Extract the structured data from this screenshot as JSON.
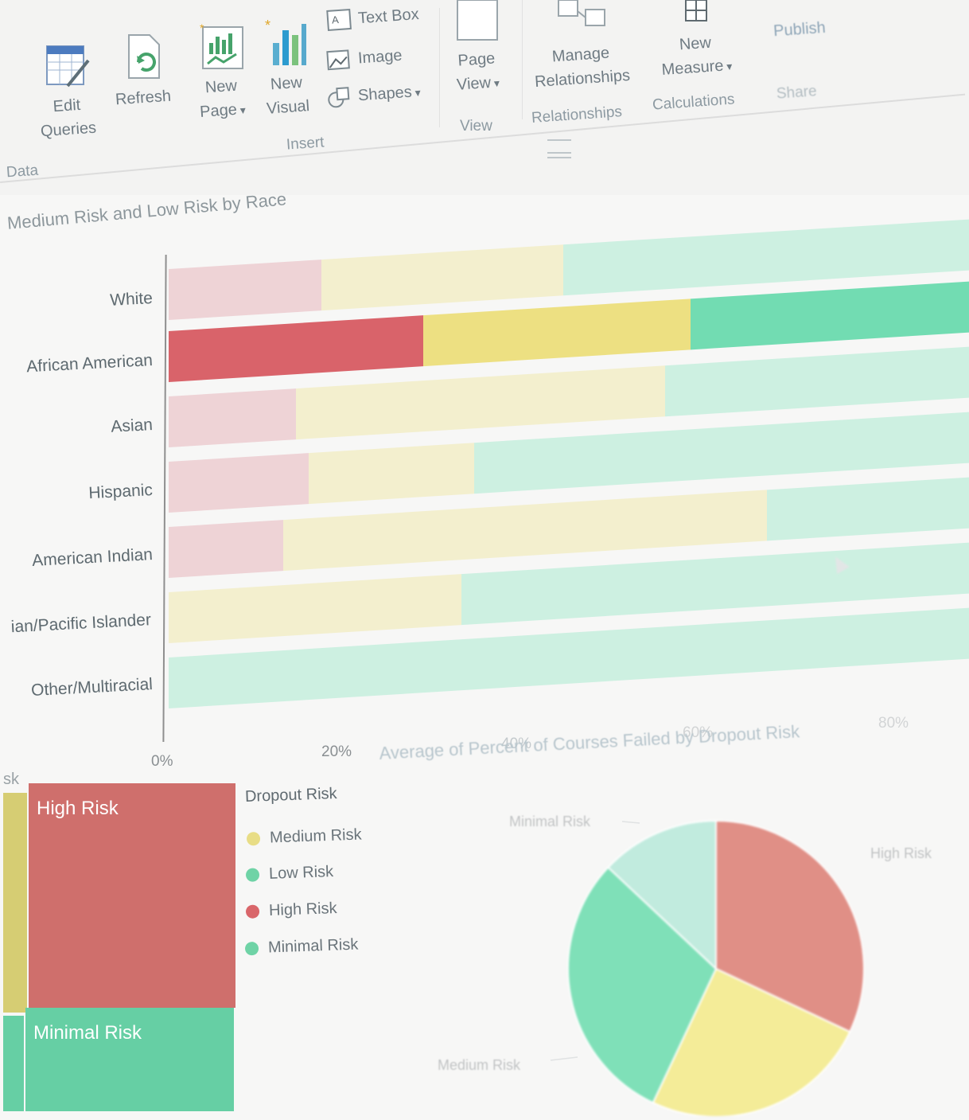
{
  "ribbon": {
    "edit_queries": "Edit\nQueries",
    "refresh": "Refresh",
    "new_page": "New\nPage",
    "new_visual": "New\nVisual",
    "text_box": "Text Box",
    "image": "Image",
    "shapes": "Shapes",
    "page_view": "Page\nView",
    "manage_relationships": "Manage\nRelationships",
    "new_measure": "New\nMeasure",
    "publish": "Publish",
    "groups": {
      "data": "Data",
      "insert": "Insert",
      "view": "View",
      "relationships": "Relationships",
      "calculations": "Calculations",
      "share": "Share"
    }
  },
  "bar_chart_title": "Medium Risk and Low Risk by Race",
  "pie_title": "Average of Percent of Courses Failed by Dropout Risk",
  "treemap": {
    "title_fragment": "sk",
    "high_risk": "High Risk",
    "minimal_risk": "Minimal Risk"
  },
  "legend": {
    "title": "Dropout Risk",
    "items": [
      {
        "label": "Medium Risk",
        "color": "#e8dd86"
      },
      {
        "label": "Low Risk",
        "color": "#6fd3a6"
      },
      {
        "label": "High Risk",
        "color": "#d9666a"
      },
      {
        "label": "Minimal Risk",
        "color": "#6fd3a6"
      }
    ]
  },
  "pie_labels": {
    "minimal": "Minimal Risk",
    "high": "High Risk",
    "medium": "Medium Risk"
  },
  "colors": {
    "high": "#d9636a",
    "medium": "#ede082",
    "low": "#72dcb2"
  },
  "chart_data": [
    {
      "type": "bar",
      "orientation": "horizontal-stacked",
      "title": "Medium Risk and Low Risk by Race",
      "categories": [
        "White",
        "African American",
        "Asian",
        "Hispanic",
        "American Indian",
        "ian/Pacific Islander",
        "Other/Multiracial"
      ],
      "series": [
        {
          "name": "High Risk",
          "values": [
            12,
            20,
            10,
            11,
            9,
            0,
            0
          ]
        },
        {
          "name": "Medium Risk",
          "values": [
            19,
            21,
            29,
            13,
            38,
            23,
            0
          ]
        },
        {
          "name": "Low Risk",
          "values": [
            69,
            59,
            61,
            76,
            53,
            77,
            100
          ]
        }
      ],
      "xticks": [
        "0%",
        "20%",
        "40%",
        "60%",
        "80%"
      ],
      "xlim": [
        0,
        100
      ],
      "highlighted_category": "African American"
    },
    {
      "type": "pie",
      "title": "Average of Percent of Courses Failed by Dropout Risk",
      "slices": [
        {
          "name": "High Risk",
          "value": 32
        },
        {
          "name": "Medium Risk",
          "value": 25
        },
        {
          "name": "Low Risk",
          "value": 30
        },
        {
          "name": "Minimal Risk",
          "value": 13
        }
      ]
    }
  ]
}
